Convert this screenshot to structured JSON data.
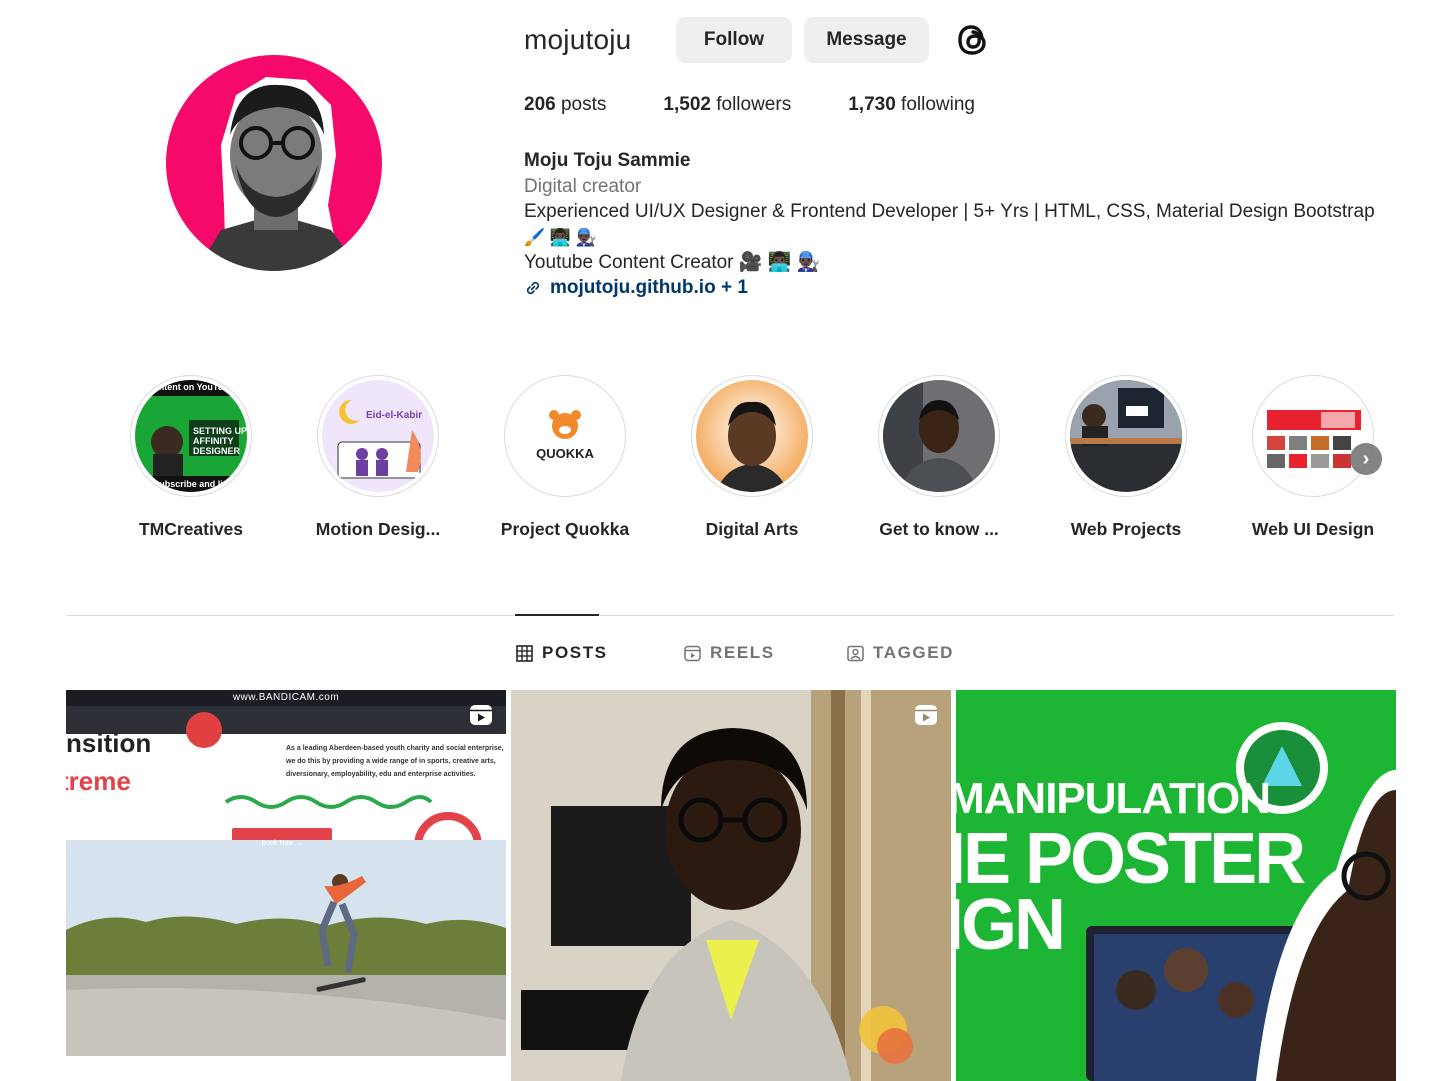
{
  "profile": {
    "username": "mojutoju",
    "follow_label": "Follow",
    "message_label": "Message",
    "threads_icon": "threads-icon",
    "avatar_bg": "#f50a6b"
  },
  "stats": {
    "posts_num": "206",
    "posts_label": "posts",
    "followers_num": "1,502",
    "followers_label": "followers",
    "following_num": "1,730",
    "following_label": "following"
  },
  "bio": {
    "full_name": "Moju Toju Sammie",
    "category": "Digital creator",
    "line1": "Experienced UI/UX Designer & Frontend Developer | 5+ Yrs | HTML, CSS, Material Design Bootstrap",
    "line2_emoji": "🖌️ 👨🏿‍💻 👨🏿‍🔧",
    "line3": "Youtube Content Creator 🎥 👨🏿‍💻 👨🏿‍🔧",
    "link_text": "mojutoju.github.io + 1"
  },
  "highlights": [
    {
      "label": "TMCreatives",
      "cover_text": "Setting up Affinity Designer",
      "cover_top": "ntent on YouTu",
      "cover_bottom": "ubscribe and li"
    },
    {
      "label": "Motion Desig...",
      "cover_text": "Eid-el-Kabir"
    },
    {
      "label": "Project Quokka",
      "cover_text": "QUOKKA"
    },
    {
      "label": "Digital Arts"
    },
    {
      "label": "Get to know ..."
    },
    {
      "label": "Web Projects"
    },
    {
      "label": "Web UI Design"
    }
  ],
  "tabs": {
    "posts": "POSTS",
    "reels": "REELS",
    "tagged": "TAGGED"
  },
  "posts": [
    {
      "banner": "www.BANDICAM.com",
      "headline1": "nsition",
      "headline2": "treme",
      "body": "As a leading Aberdeen-based youth charity and social enterprise, we do this by providing a wide range of in sports, creative arts, diversionary, employability, edu and enterprise activities.",
      "cta": "Book Now →",
      "type_icon": "reel-icon"
    },
    {
      "type_icon": "reel-icon"
    },
    {
      "headline1": "MANIPULATION",
      "headline2": "IE POSTER",
      "headline3": "IGN"
    }
  ],
  "colors": {
    "link": "#00376b",
    "muted": "#737373",
    "post3_bg": "#1db534"
  }
}
